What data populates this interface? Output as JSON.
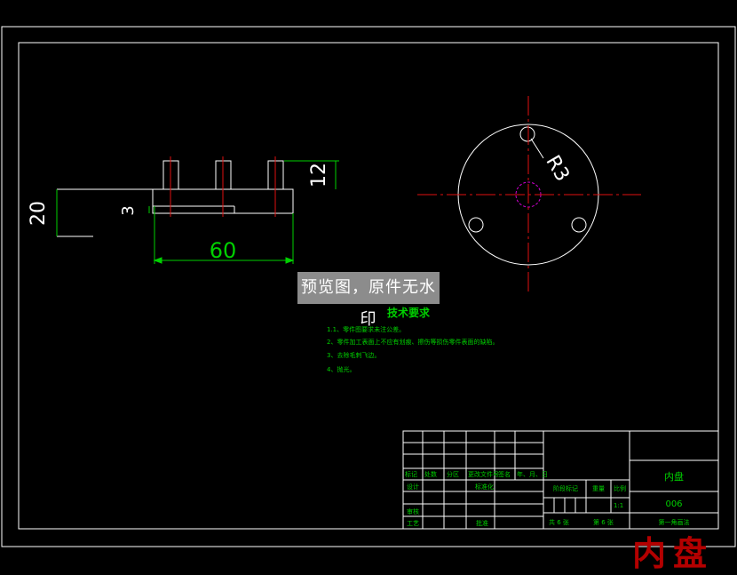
{
  "dimensions": {
    "height_left": "20",
    "step_height": "3",
    "width": "60",
    "pin_height": "12",
    "hole_radius": "R3"
  },
  "tech_requirements": {
    "title": "技术要求",
    "items": [
      "1.1、零件图要求未注公差。",
      "2、零件加工表面上不应有划痕、擦伤等损伤零件表面的缺陷。",
      "3、去除毛刺飞边。",
      "4、抛光。"
    ]
  },
  "title_block": {
    "header_labels": [
      "标记",
      "处数",
      "分区",
      "更改文件号",
      "签名",
      "年、月、日"
    ],
    "row_labels": [
      "设计",
      "标准化",
      "审核",
      "工艺",
      "批准"
    ],
    "stage_label": "阶段标记",
    "weight_label": "重量",
    "scale_label": "比例",
    "scale_value": "1:1",
    "sheets_total": "共 6 张",
    "sheet_no": "第 6 张",
    "part_name": "内盘",
    "drawing_no": "006",
    "projection": "第一角画法"
  },
  "watermark": "预览图，原件无水印",
  "brand_text": "内盘",
  "colors": {
    "background": "#000000",
    "outline": "#ffffff",
    "centerline": "#e01010",
    "dimension": "#00d000",
    "hidden": "#d000d0",
    "brand": "#b30000"
  }
}
